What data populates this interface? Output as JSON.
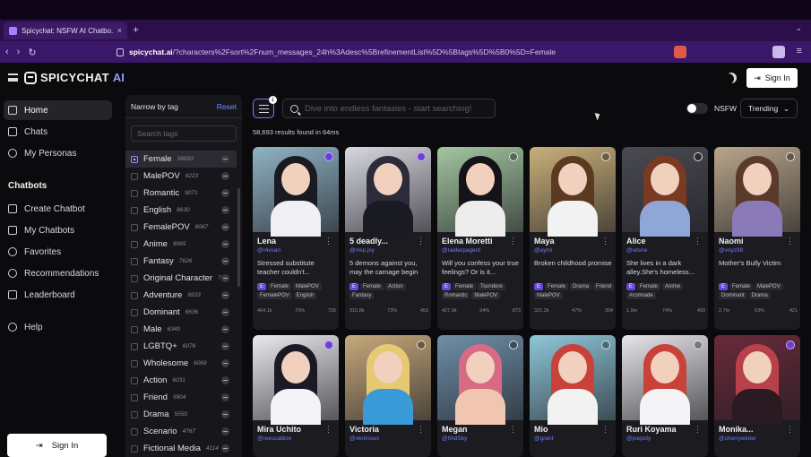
{
  "browser": {
    "tab_title": "Spicychat: NSFW AI Chatbo...",
    "tab_close": "×",
    "new_tab": "+",
    "url_host": "spicychat.ai",
    "url_path": "/?characters%2Fsort%2Fnum_messages_24h%3Adesc%5BrefinementList%5D%5Btags%5D%5B0%5D=Female"
  },
  "header": {
    "logo_text": "SPICYCHAT",
    "logo_suffix": "AI",
    "signin_label": "Sign In"
  },
  "sidebar": {
    "nav": [
      {
        "label": "Home",
        "icon": "home-icon"
      },
      {
        "label": "Chats",
        "icon": "chat-icon"
      },
      {
        "label": "My Personas",
        "icon": "personas-icon"
      }
    ],
    "chatbots_heading": "Chatbots",
    "chatbots": [
      {
        "label": "Create Chatbot",
        "icon": "plus-icon"
      },
      {
        "label": "My Chatbots",
        "icon": "bot-icon"
      },
      {
        "label": "Favorites",
        "icon": "heart-icon"
      },
      {
        "label": "Recommendations",
        "icon": "people-icon"
      },
      {
        "label": "Leaderboard",
        "icon": "trophy-icon"
      }
    ],
    "help_label": "Help",
    "signin_label": "Sign In"
  },
  "filter": {
    "title": "Narrow by tag",
    "reset": "Reset",
    "search_placeholder": "Search tags",
    "tags": [
      {
        "name": "Female",
        "count": "58693",
        "selected": true
      },
      {
        "name": "MalePOV",
        "count": "9223"
      },
      {
        "name": "Romantic",
        "count": "9071"
      },
      {
        "name": "English",
        "count": "8630"
      },
      {
        "name": "FemalePOV",
        "count": "8067"
      },
      {
        "name": "Anime",
        "count": "8065"
      },
      {
        "name": "Fantasy",
        "count": "7626"
      },
      {
        "name": "Original Character",
        "count": "7..."
      },
      {
        "name": "Adventure",
        "count": "6933"
      },
      {
        "name": "Dominant",
        "count": "6636"
      },
      {
        "name": "Male",
        "count": "6340"
      },
      {
        "name": "LGBTQ+",
        "count": "6076"
      },
      {
        "name": "Wholesome",
        "count": "6069"
      },
      {
        "name": "Action",
        "count": "6031"
      },
      {
        "name": "Friend",
        "count": "5904"
      },
      {
        "name": "Drama",
        "count": "5550"
      },
      {
        "name": "Scenario",
        "count": "4767"
      },
      {
        "name": "Fictional Media",
        "count": "4114"
      }
    ]
  },
  "main": {
    "filter_badge": "1",
    "search_placeholder": "Dive into endless fantasies - start searching!",
    "results_text": "58,693 results found in 64ms",
    "nsfw_label": "NSFW",
    "sort_label": "Trending",
    "sort_chevron": "⌄",
    "cards": [
      {
        "name": "Lena",
        "handle": "@r4vsan",
        "desc": "Stressed substitute teacher couldn't...",
        "tags": [
          "Female",
          "MalePOV",
          "FemalePOV",
          "English"
        ],
        "stats": [
          "464.1k",
          "70%",
          "726"
        ],
        "palette": [
          "#8fb3c4",
          "#1a1a22",
          "#f0f0f2"
        ]
      },
      {
        "name": "5 deadly...",
        "handle": "@rrep.jsy",
        "desc": "5 demons against you, may the carnage begin",
        "tags": [
          "Female",
          "Action",
          "Fantasy"
        ],
        "stats": [
          "315.8k",
          "73%",
          "453"
        ],
        "palette": [
          "#d8d8e0",
          "#2b2b3a",
          "#1a1a22"
        ]
      },
      {
        "name": "Elena Moretti",
        "handle": "@raiderpagent",
        "desc": "Will you confess your true feelings? Or is it...",
        "tags": [
          "Female",
          "Tsundere",
          "Romantic",
          "MalePOV"
        ],
        "stats": [
          "427.9k",
          "94%",
          "873"
        ],
        "palette": [
          "#a3c6a0",
          "#141418",
          "#ededee"
        ]
      },
      {
        "name": "Maya",
        "handle": "@ayrci",
        "desc": "Broken childhood promise",
        "tags": [
          "Female",
          "Drama",
          "Friend",
          "MalePOV"
        ],
        "stats": [
          "321.2k",
          "47%",
          "304"
        ],
        "palette": [
          "#c9b07a",
          "#5c3a22",
          "#f2f2f2"
        ]
      },
      {
        "name": "Alice",
        "handle": "@wlsne",
        "desc": "She lives in a dark alley.She's homeless...",
        "tags": [
          "Female",
          "Anime",
          "#comrade"
        ],
        "stats": [
          "1.9m",
          "74%",
          "493"
        ],
        "palette": [
          "#4a4a52",
          "#7a3a22",
          "#8fa7d6"
        ]
      },
      {
        "name": "Naomi",
        "handle": "@voyz98",
        "desc": "Mother's Bully Victim",
        "tags": [
          "Female",
          "MalePOV",
          "Dominant",
          "Drama"
        ],
        "stats": [
          "2.7m",
          "63%",
          "421"
        ],
        "palette": [
          "#b9a58a",
          "#5a3a2a",
          "#8a7bb8"
        ]
      },
      {
        "name": "Mira Uchito",
        "handle": "@reescalibre",
        "desc": "",
        "tags": [],
        "stats": [],
        "palette": [
          "#e9e9ee",
          "#1a1a24",
          "#f4f4f8"
        ]
      },
      {
        "name": "Victoria",
        "handle": "@nkrimson",
        "desc": "",
        "tags": [],
        "stats": [],
        "palette": [
          "#c7a97c",
          "#e6c972",
          "#3a9ad8"
        ]
      },
      {
        "name": "Megan",
        "handle": "@hhdSky",
        "desc": "",
        "tags": [],
        "stats": [],
        "palette": [
          "#6f8fa8",
          "#d86a84",
          "#f0c6b0"
        ]
      },
      {
        "name": "Mio",
        "handle": "@grant",
        "desc": "",
        "tags": [],
        "stats": [],
        "palette": [
          "#8fc7d8",
          "#c8423a",
          "#f2f2f2"
        ]
      },
      {
        "name": "Ruri Koyama",
        "handle": "@joepoly",
        "desc": "",
        "tags": [],
        "stats": [],
        "palette": [
          "#e6e6ea",
          "#c8423a",
          "#f4f4f6"
        ]
      },
      {
        "name": "Monika...",
        "handle": "@cherrywinter",
        "desc": "",
        "tags": [],
        "stats": [],
        "palette": [
          "#6a2a3a",
          "#b8404a",
          "#2a1a22"
        ]
      }
    ]
  },
  "colors": {
    "accent": "#6f7cff",
    "brand_purple": "#3a1768",
    "panel": "#17171b"
  }
}
